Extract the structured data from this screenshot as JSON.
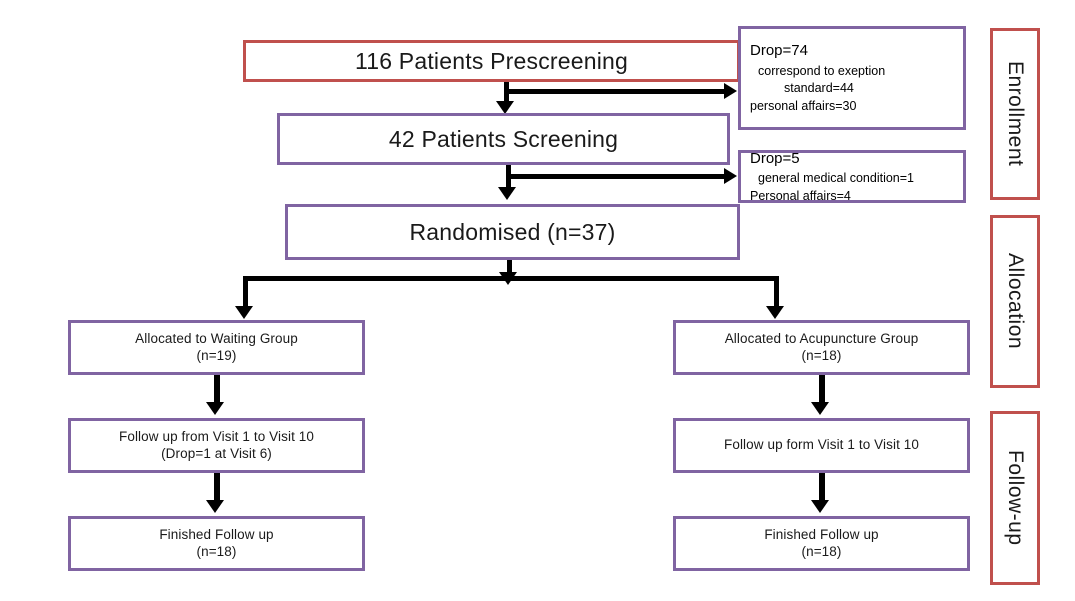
{
  "diagram": {
    "title": "CONSORT participant flow diagram",
    "colors": {
      "primary_border_red": "#C0504D",
      "primary_border_purple": "#8064A2",
      "connector": "#000000",
      "background": "#FFFFFF"
    }
  },
  "nodes": {
    "prescreening": {
      "label": "116 Patients Prescreening"
    },
    "screening": {
      "label": "42 Patients Screening"
    },
    "randomised": {
      "label": "Randomised (n=37)"
    },
    "alloc_left": {
      "label": "Allocated to Waiting Group\n(n=19)"
    },
    "alloc_right": {
      "label": "Allocated to Acupuncture Group\n(n=18)"
    },
    "followup_left": {
      "label": "Follow up from Visit 1 to Visit 10\n(Drop=1 at Visit 6)"
    },
    "followup_right": {
      "label": "Follow up form Visit 1 to Visit 10"
    },
    "finished_left": {
      "label": "Finished Follow up\n(n=18)"
    },
    "finished_right": {
      "label": "Finished Follow up\n(n=18)"
    }
  },
  "notes": {
    "drop_1": {
      "head": "Drop=74",
      "line1": "correspond to exeption",
      "line2": "standard=44",
      "line3": "personal affairs=30"
    },
    "drop_2": {
      "head": "Drop=5",
      "line1": "general medical condition=1",
      "line2": "Personal affairs=4"
    }
  },
  "phases": {
    "enrollment": {
      "label": "Enrollment"
    },
    "allocation": {
      "label": "Allocation"
    },
    "followup": {
      "label": "Follow-up"
    }
  }
}
